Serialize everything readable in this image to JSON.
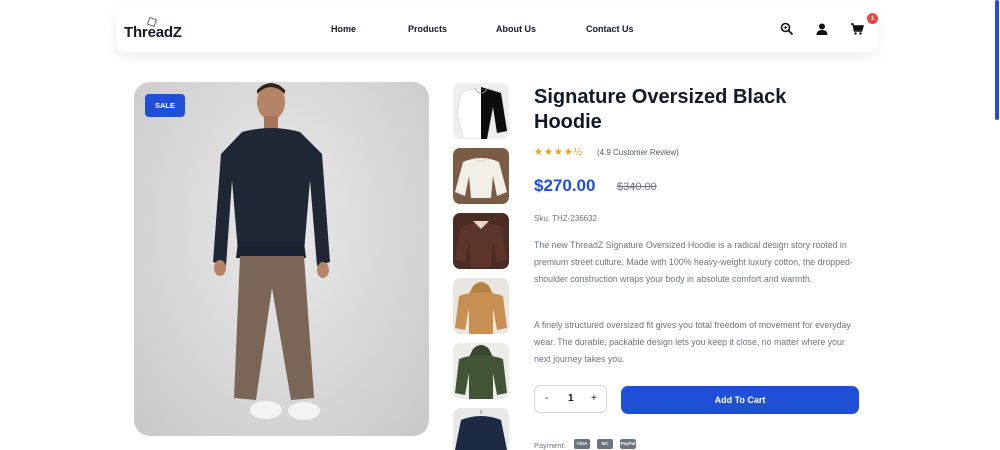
{
  "header": {
    "logo": "ThreadZ",
    "nav": [
      "Home",
      "Products",
      "About Us",
      "Contact Us"
    ],
    "cart_count": "1"
  },
  "product": {
    "badge": "SALE",
    "title": "Signature Oversized Black Hoodie",
    "rating_stars": "★★★★½",
    "review": "(4.9 Customer Review)",
    "price": "$270.00",
    "old_price": "$340.00",
    "sku": "Sku: THZ-236632",
    "description_1": "The new ThreadZ Signature Oversized Hoodie is a radical design story rooted in premium street culture. Made with 100% heavy-weight luxury cotton, the dropped-shoulder construction wraps your body in absolute comfort and warmth.",
    "description_2": "A finely structured oversized fit gives you total freedom of movement for everyday wear. The durable, packable design lets you keep it close, no matter where your next journey takes you.",
    "quantity": "1",
    "qty_minus": "-",
    "qty_plus": "+",
    "add_to_cart": "Add To Cart",
    "payment_label": "Payment:",
    "payment_methods": [
      "VISA",
      "MC",
      "PayPal"
    ]
  },
  "colors": {
    "accent": "#1f4fd6",
    "badge_red": "#ef4444",
    "star": "#f59e0b"
  }
}
